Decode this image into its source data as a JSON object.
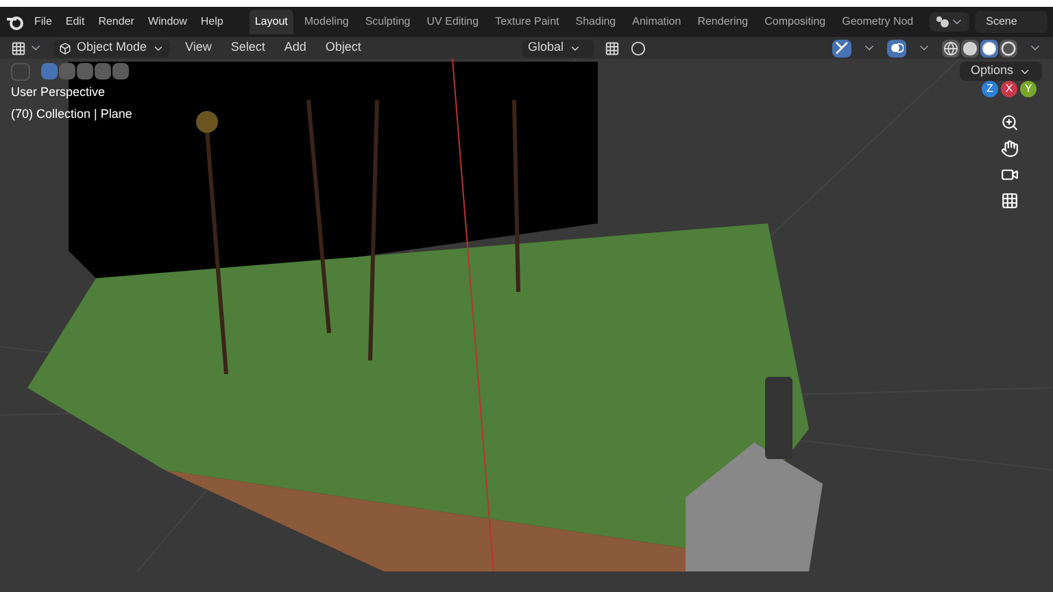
{
  "menus": [
    "File",
    "Edit",
    "Render",
    "Window",
    "Help"
  ],
  "workspaces": [
    {
      "label": "Layout",
      "selected": true
    },
    {
      "label": "Modeling",
      "selected": false
    },
    {
      "label": "Sculpting",
      "selected": false
    },
    {
      "label": "UV Editing",
      "selected": false
    },
    {
      "label": "Texture Paint",
      "selected": false
    },
    {
      "label": "Shading",
      "selected": false
    },
    {
      "label": "Animation",
      "selected": false
    },
    {
      "label": "Rendering",
      "selected": false
    },
    {
      "label": "Compositing",
      "selected": false
    },
    {
      "label": "Geometry Nod",
      "selected": false
    }
  ],
  "scene": "Scene",
  "header": {
    "mode": "Object Mode",
    "menus": [
      "View",
      "Select",
      "Add",
      "Object"
    ],
    "orientation": "Global",
    "gizmos_on": true,
    "overlays_on": true
  },
  "select_modes": [
    {
      "selected": true
    },
    {
      "selected": false
    },
    {
      "selected": false
    },
    {
      "selected": false
    },
    {
      "selected": false
    }
  ],
  "shading_modes": [
    {
      "kind": "wireframe",
      "selected": false
    },
    {
      "kind": "solid",
      "selected": false
    },
    {
      "kind": "material",
      "selected": true
    },
    {
      "kind": "rendered",
      "selected": false
    }
  ],
  "viewport": {
    "view_name": "User Perspective",
    "collection": "(70) Collection | Plane",
    "options": "Options"
  },
  "gizmo_axes": [
    {
      "label": "Z",
      "color": "#2f7fd6"
    },
    {
      "label": "X",
      "color": "#c8384a"
    },
    {
      "label": "Y",
      "color": "#7aa72a"
    }
  ]
}
